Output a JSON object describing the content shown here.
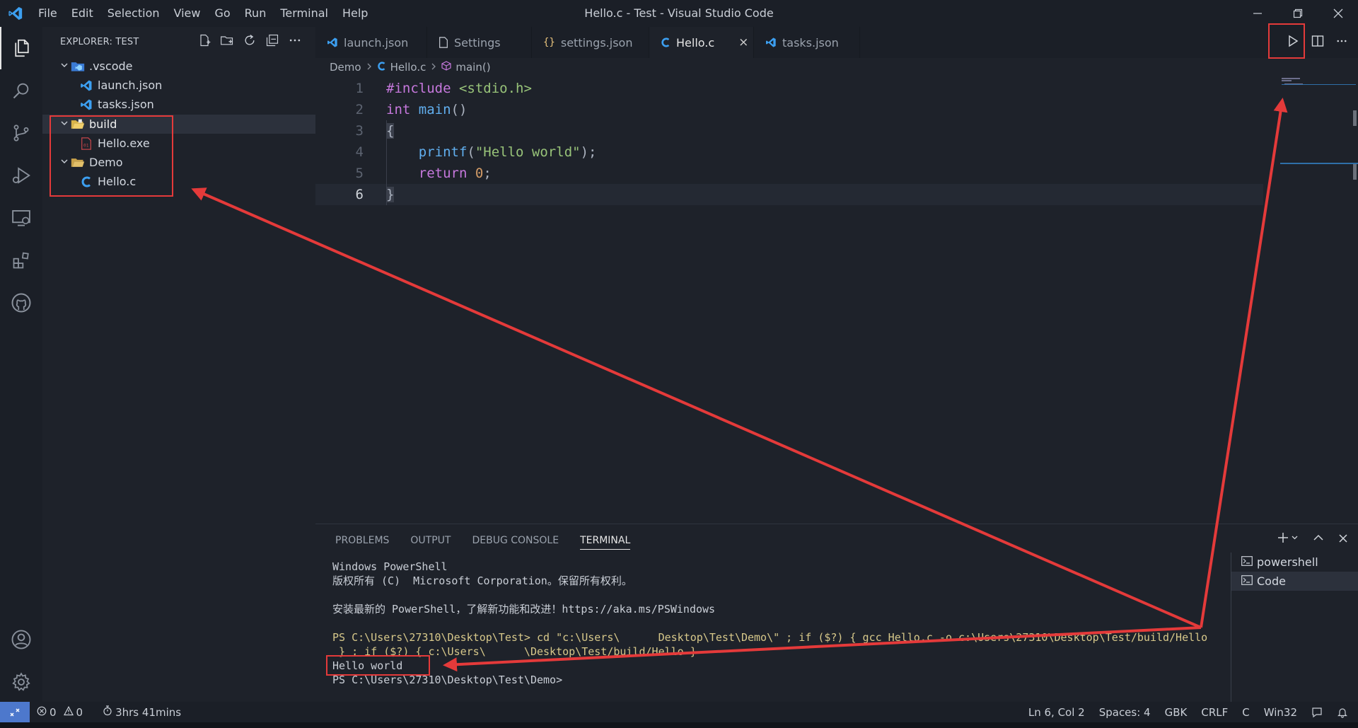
{
  "window": {
    "title": "Hello.c - Test - Visual Studio Code"
  },
  "menu": [
    "File",
    "Edit",
    "Selection",
    "View",
    "Go",
    "Run",
    "Terminal",
    "Help"
  ],
  "explorer": {
    "title": "EXPLORER: TEST",
    "tree": [
      {
        "label": ".vscode",
        "icon": "vscode-folder-icon",
        "indent": 0,
        "folder": true
      },
      {
        "label": "launch.json",
        "icon": "vscode-file-icon",
        "indent": 1,
        "folder": false
      },
      {
        "label": "tasks.json",
        "icon": "vscode-file-icon",
        "indent": 1,
        "folder": false
      },
      {
        "label": "build",
        "icon": "folder-open-icon",
        "indent": 0,
        "folder": true,
        "selected": true
      },
      {
        "label": "Hello.exe",
        "icon": "exe-file-icon",
        "indent": 1,
        "folder": false
      },
      {
        "label": "Demo",
        "icon": "folder-open-icon",
        "indent": 0,
        "folder": true
      },
      {
        "label": "Hello.c",
        "icon": "c-file-icon",
        "indent": 1,
        "folder": false
      }
    ]
  },
  "tabs": [
    {
      "label": "launch.json",
      "icon": "vscode-file-icon"
    },
    {
      "label": "Settings",
      "icon": "file-icon"
    },
    {
      "label": "settings.json",
      "icon": "json-braces-icon"
    },
    {
      "label": "Hello.c",
      "icon": "c-file-icon",
      "active": true,
      "close": "×"
    },
    {
      "label": "tasks.json",
      "icon": "vscode-file-icon"
    }
  ],
  "breadcrumb": [
    "Demo",
    "Hello.c",
    "main()"
  ],
  "code": {
    "current_line": 6,
    "lines": [
      "1",
      "2",
      "3",
      "4",
      "5",
      "6"
    ]
  },
  "panel": {
    "tabs": [
      "PROBLEMS",
      "OUTPUT",
      "DEBUG CONSOLE",
      "TERMINAL"
    ],
    "active_tab": "TERMINAL",
    "terminal_lines": [
      "Windows PowerShell",
      "版权所有 (C)  Microsoft Corporation。保留所有权利。",
      "",
      "安装最新的 PowerShell，了解新功能和改进！https://aka.ms/PSWindows",
      "",
      "PS C:\\Users\\27310\\Desktop\\Test> cd \"c:\\Users\\      Desktop\\Test\\Demo\\\" ; if ($?) { gcc Hello.c -o c:\\Users\\27310\\Desktop\\Test/build/Hello",
      " } ; if ($?) { c:\\Users\\      \\Desktop\\Test/build/Hello }",
      "Hello world",
      "PS C:\\Users\\27310\\Desktop\\Test\\Demo>"
    ],
    "terminals": [
      {
        "label": "powershell",
        "selected": false
      },
      {
        "label": "Code",
        "selected": true
      }
    ]
  },
  "status": {
    "errors": "0",
    "warnings": "0",
    "timer": "3hrs 41mins",
    "position": "Ln 6, Col 2",
    "spaces": "Spaces: 4",
    "encoding": "GBK",
    "eol": "CRLF",
    "language": "C",
    "platform": "Win32"
  },
  "colors": {
    "accent": "#4d78cc",
    "annotation": "#e43a3a",
    "background": "#1e222a"
  }
}
